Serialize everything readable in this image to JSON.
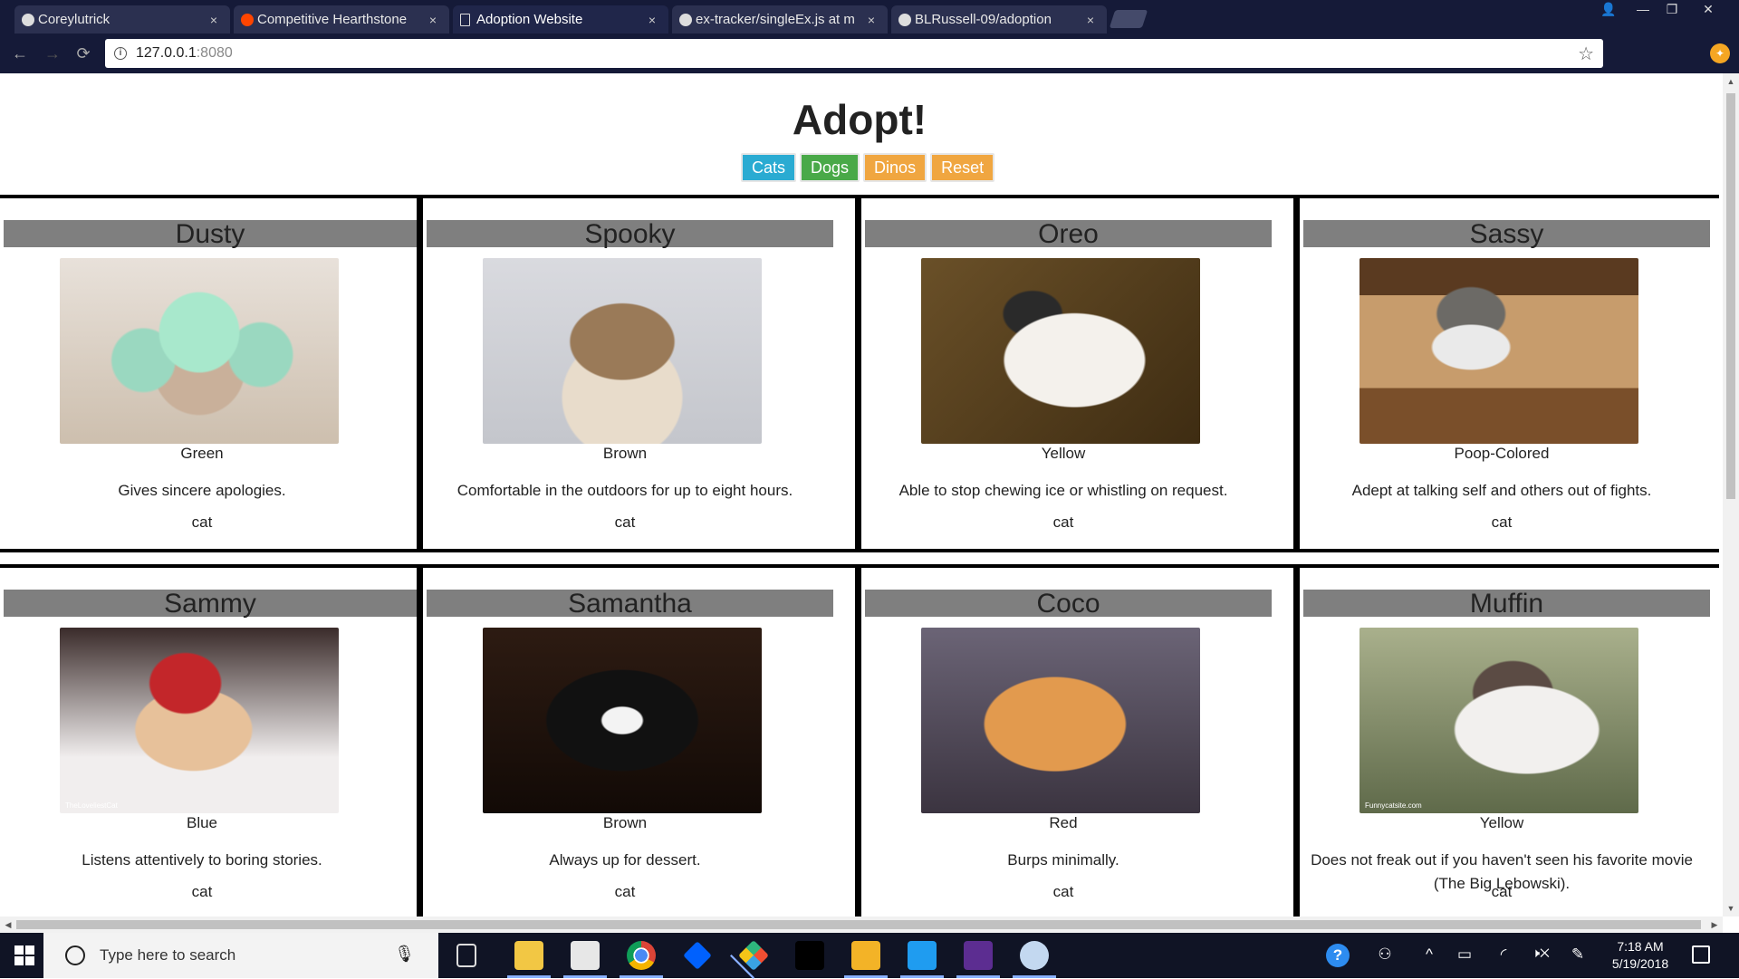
{
  "browser": {
    "tabs": [
      {
        "title": "Coreylutrick",
        "favicon": "github-icon",
        "active": false
      },
      {
        "title": "Competitive Hearthstone",
        "favicon": "reddit-icon",
        "active": false
      },
      {
        "title": "Adoption Website",
        "favicon": "document-icon",
        "active": true
      },
      {
        "title": "ex-tracker/singleEx.js at m",
        "favicon": "github-icon",
        "active": false
      },
      {
        "title": "BLRussell-09/adoption",
        "favicon": "github-icon",
        "active": false
      }
    ],
    "close_glyph": "×",
    "url_host": "127.0.0.1",
    "url_port": ":8080",
    "window_controls": {
      "user": "👤",
      "minimize": "—",
      "restore": "❐",
      "close": "✕"
    },
    "nav": {
      "back": "←",
      "forward": "→",
      "reload": "⟳"
    },
    "star_glyph": "☆",
    "info_glyph": "i",
    "extension_glyph": "✦"
  },
  "page": {
    "title": "Adopt!",
    "filters": [
      {
        "label": "Cats",
        "color": "#2aabd2"
      },
      {
        "label": "Dogs",
        "color": "#49a948"
      },
      {
        "label": "Dinos",
        "color": "#f0a640"
      },
      {
        "label": "Reset",
        "color": "#f0a640"
      }
    ],
    "pets": [
      {
        "name": "Dusty",
        "color": "Green",
        "special_skill": "Gives sincere apologies.",
        "type": "cat",
        "photo": "cat-in-green-knit-hat"
      },
      {
        "name": "Spooky",
        "color": "Brown",
        "special_skill": "Comfortable in the outdoors for up to eight hours.",
        "type": "cat",
        "photo": "maine-coon-cat"
      },
      {
        "name": "Oreo",
        "color": "Yellow",
        "special_skill": "Able to stop chewing ice or whistling on request.",
        "type": "cat",
        "photo": "laughing-white-cat"
      },
      {
        "name": "Sassy",
        "color": "Poop-Colored",
        "special_skill": "Adept at talking self and others out of fights.",
        "type": "cat",
        "photo": "cat-in-paper-roll"
      },
      {
        "name": "Sammy",
        "color": "Blue",
        "special_skill": "Listens attentively to boring stories.",
        "type": "cat",
        "photo": "grumpy-cat-red-devil-hat",
        "watermark": "TheLoveliestCat"
      },
      {
        "name": "Samantha",
        "color": "Brown",
        "special_skill": "Always up for dessert.",
        "type": "cat",
        "photo": "black-white-scottish-fold"
      },
      {
        "name": "Coco",
        "color": "Red",
        "special_skill": "Burps minimally.",
        "type": "cat",
        "photo": "orange-kitten-waving"
      },
      {
        "name": "Muffin",
        "color": "Yellow",
        "special_skill": "Does not freak out if you haven't seen his favorite movie (The Big Lebowski).",
        "type": "cat",
        "photo": "screaming-siamese-cat",
        "watermark": "Funnycatsite.com"
      }
    ]
  },
  "scrollbars": {
    "up": "▲",
    "down": "▼",
    "left": "◀",
    "right": "▶"
  },
  "taskbar": {
    "search_placeholder": "Type here to search",
    "mic_glyph": "🎙",
    "apps": [
      "task-view",
      "file-explorer",
      "store",
      "chrome",
      "dropbox",
      "git",
      "netflix",
      "sway",
      "vscode",
      "visual-studio",
      "paint"
    ],
    "tray": {
      "help": "?",
      "people": "⚇",
      "chevron": "^",
      "battery": "▭",
      "wifi": "◜",
      "volume": "🕨✕",
      "pen": "✎"
    },
    "time": "7:18 AM",
    "date": "5/19/2018"
  }
}
